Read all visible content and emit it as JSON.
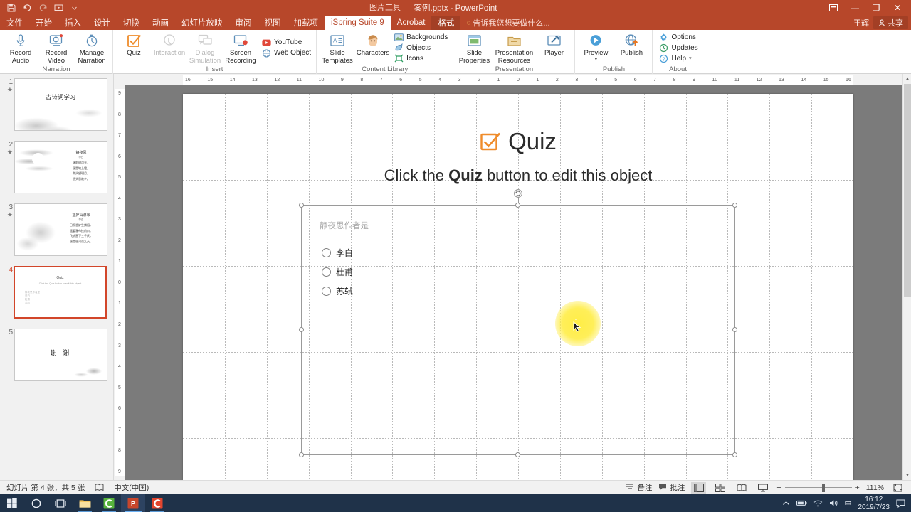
{
  "window": {
    "doc_title": "案例.pptx - PowerPoint",
    "context_tab_group": "图片工具",
    "user_name": "王辉",
    "share_label": "共享",
    "minimize": "—",
    "restore": "❐",
    "close": "✕",
    "ribbon_display": "ribbon-display-icon"
  },
  "quick_access": {
    "save": "save-icon",
    "undo": "undo-icon",
    "redo": "redo-icon",
    "present": "start-presentation-icon",
    "more": "customize-qat-icon"
  },
  "tabs": [
    {
      "label": "文件",
      "active": false,
      "ctx": false
    },
    {
      "label": "开始",
      "active": false,
      "ctx": false
    },
    {
      "label": "插入",
      "active": false,
      "ctx": false
    },
    {
      "label": "设计",
      "active": false,
      "ctx": false
    },
    {
      "label": "切换",
      "active": false,
      "ctx": false
    },
    {
      "label": "动画",
      "active": false,
      "ctx": false
    },
    {
      "label": "幻灯片放映",
      "active": false,
      "ctx": false
    },
    {
      "label": "审阅",
      "active": false,
      "ctx": false
    },
    {
      "label": "视图",
      "active": false,
      "ctx": false
    },
    {
      "label": "加载项",
      "active": false,
      "ctx": false
    },
    {
      "label": "iSpring Suite 9",
      "active": true,
      "ctx": false
    },
    {
      "label": "Acrobat",
      "active": false,
      "ctx": false
    },
    {
      "label": "格式",
      "active": false,
      "ctx": true
    }
  ],
  "tell_me": "告诉我您想要做什么...",
  "ribbon": {
    "groups": [
      {
        "label": "Narration",
        "big_buttons": [
          {
            "name": "record-audio",
            "label": "Record\nAudio",
            "icon": "microphone-icon",
            "dim": false
          },
          {
            "name": "record-video",
            "label": "Record\nVideo",
            "icon": "webcam-icon",
            "dim": false
          },
          {
            "name": "manage-narration",
            "label": "Manage\nNarration",
            "icon": "stopwatch-icon",
            "dim": false
          }
        ],
        "small_buttons": []
      },
      {
        "label": "Insert",
        "big_buttons": [
          {
            "name": "quiz",
            "label": "Quiz",
            "icon": "quiz-check-icon",
            "dim": false
          },
          {
            "name": "interaction",
            "label": "Interaction",
            "icon": "interaction-icon",
            "dim": true
          },
          {
            "name": "dialog-simulation",
            "label": "Dialog\nSimulation",
            "icon": "dialog-icon",
            "dim": true
          },
          {
            "name": "screen-recording",
            "label": "Screen\nRecording",
            "icon": "screen-record-icon",
            "dim": false
          }
        ],
        "small_buttons": [
          {
            "name": "youtube",
            "label": "YouTube",
            "icon": "youtube-icon"
          },
          {
            "name": "web-object",
            "label": "Web Object",
            "icon": "web-object-icon"
          }
        ]
      },
      {
        "label": "Content Library",
        "big_buttons": [
          {
            "name": "slide-templates",
            "label": "Slide\nTemplates",
            "icon": "slide-template-icon",
            "dim": false
          },
          {
            "name": "characters",
            "label": "Characters",
            "icon": "character-icon",
            "dim": false
          }
        ],
        "small_buttons": [
          {
            "name": "backgrounds",
            "label": "Backgrounds",
            "icon": "background-icon"
          },
          {
            "name": "objects",
            "label": "Objects",
            "icon": "objects-icon"
          },
          {
            "name": "icons",
            "label": "Icons",
            "icon": "icons-icon"
          }
        ]
      },
      {
        "label": "Presentation",
        "big_buttons": [
          {
            "name": "slide-properties",
            "label": "Slide\nProperties",
            "icon": "slide-properties-icon",
            "dim": false
          },
          {
            "name": "presentation-resources",
            "label": "Presentation\nResources",
            "icon": "resources-icon",
            "dim": false
          },
          {
            "name": "player",
            "label": "Player",
            "icon": "player-wrench-icon",
            "dim": false
          }
        ],
        "small_buttons": []
      },
      {
        "label": "Publish",
        "big_buttons": [
          {
            "name": "preview",
            "label": "Preview",
            "icon": "preview-play-icon",
            "dim": false,
            "caret": "▾"
          },
          {
            "name": "publish",
            "label": "Publish",
            "icon": "publish-globe-icon",
            "dim": false
          }
        ],
        "small_buttons": []
      },
      {
        "label": "About",
        "big_buttons": [],
        "small_buttons": [
          {
            "name": "options",
            "label": "Options",
            "icon": "gear-icon"
          },
          {
            "name": "updates",
            "label": "Updates",
            "icon": "updates-icon"
          },
          {
            "name": "help",
            "label": "Help",
            "icon": "help-icon",
            "caret": "▾"
          }
        ]
      }
    ]
  },
  "slides": [
    {
      "num": "1",
      "starred": true,
      "selected": false,
      "kind": "title",
      "title": "古诗词学习"
    },
    {
      "num": "2",
      "starred": true,
      "selected": false,
      "kind": "poem-moon",
      "poem_title": "静夜思",
      "poem_author": "李白",
      "poem_lines": [
        "床前明月光，",
        "疑是地上霜。",
        "举头望明月，",
        "低头思故乡。"
      ]
    },
    {
      "num": "3",
      "starred": true,
      "selected": false,
      "kind": "poem-mountain",
      "poem_title": "望庐山瀑布",
      "poem_author": "李白",
      "poem_lines": [
        "日照香炉生紫烟，",
        "遥看瀑布挂前川。",
        "飞流直下三千尺，",
        "疑是银河落九天。"
      ]
    },
    {
      "num": "4",
      "starred": false,
      "selected": true,
      "kind": "quiz",
      "quiz_title": "Quiz",
      "quiz_sub": "Click the Quiz button to edit this object"
    },
    {
      "num": "5",
      "starred": false,
      "selected": false,
      "kind": "thanks",
      "title": "谢 谢"
    }
  ],
  "slide_canvas": {
    "quiz_title": "Quiz",
    "sub_before": "Click the ",
    "sub_bold": "Quiz",
    "sub_after": " button to edit this object",
    "quiz_prompt": "静夜思作者是",
    "options": [
      "李白",
      "杜甫",
      "苏轼"
    ],
    "accent_color": "#ef8c2b"
  },
  "rulers": {
    "horizontal": [
      "16",
      "15",
      "14",
      "13",
      "12",
      "11",
      "10",
      "9",
      "8",
      "7",
      "6",
      "5",
      "4",
      "3",
      "2",
      "1",
      "0",
      "1",
      "2",
      "3",
      "4",
      "5",
      "6",
      "7",
      "8",
      "9",
      "10",
      "11",
      "12",
      "13",
      "14",
      "15",
      "16"
    ],
    "vertical": [
      "9",
      "8",
      "7",
      "6",
      "5",
      "4",
      "3",
      "2",
      "1",
      "0",
      "1",
      "2",
      "3",
      "4",
      "5",
      "6",
      "7",
      "8",
      "9"
    ]
  },
  "statusbar": {
    "slide_count": "幻灯片 第 4 张，共 5 张",
    "language_icon": "proofing-icon",
    "language": "中文(中国)",
    "notes_label": "备注",
    "notes_icon": "notes-icon",
    "comments_label": "批注",
    "comments_icon": "comment-icon",
    "views": [
      {
        "name": "normal-view",
        "icon": "normal-view-icon",
        "active": true
      },
      {
        "name": "slide-sorter-view",
        "icon": "slide-sorter-icon",
        "active": false
      },
      {
        "name": "reading-view",
        "icon": "reading-view-icon",
        "active": false
      },
      {
        "name": "slideshow-view",
        "icon": "slideshow-icon",
        "active": false
      }
    ],
    "zoom_out": "−",
    "zoom_in": "+",
    "zoom_level": "111%",
    "fit_icon": "fit-to-window-icon"
  },
  "taskbar": {
    "items": [
      {
        "name": "start-button",
        "icon": "windows-logo-icon",
        "state": "none"
      },
      {
        "name": "cortana-search",
        "icon": "circle-search-icon",
        "state": "none"
      },
      {
        "name": "task-view",
        "icon": "task-view-icon",
        "state": "none"
      },
      {
        "name": "file-explorer",
        "icon": "folder-icon",
        "state": "running"
      },
      {
        "name": "camtasia-app",
        "icon": "green-c-icon",
        "state": "running"
      },
      {
        "name": "powerpoint-app",
        "icon": "powerpoint-icon",
        "state": "active"
      },
      {
        "name": "camtasia-recorder-app",
        "icon": "red-c-icon",
        "state": "running"
      }
    ],
    "tray": {
      "show_hidden": "chevron-up-icon",
      "battery": "battery-icon",
      "network": "wifi-icon",
      "volume": "volume-icon",
      "ime": "中",
      "time": "16:12",
      "date": "2019/7/23",
      "action_center": "action-center-icon"
    }
  }
}
